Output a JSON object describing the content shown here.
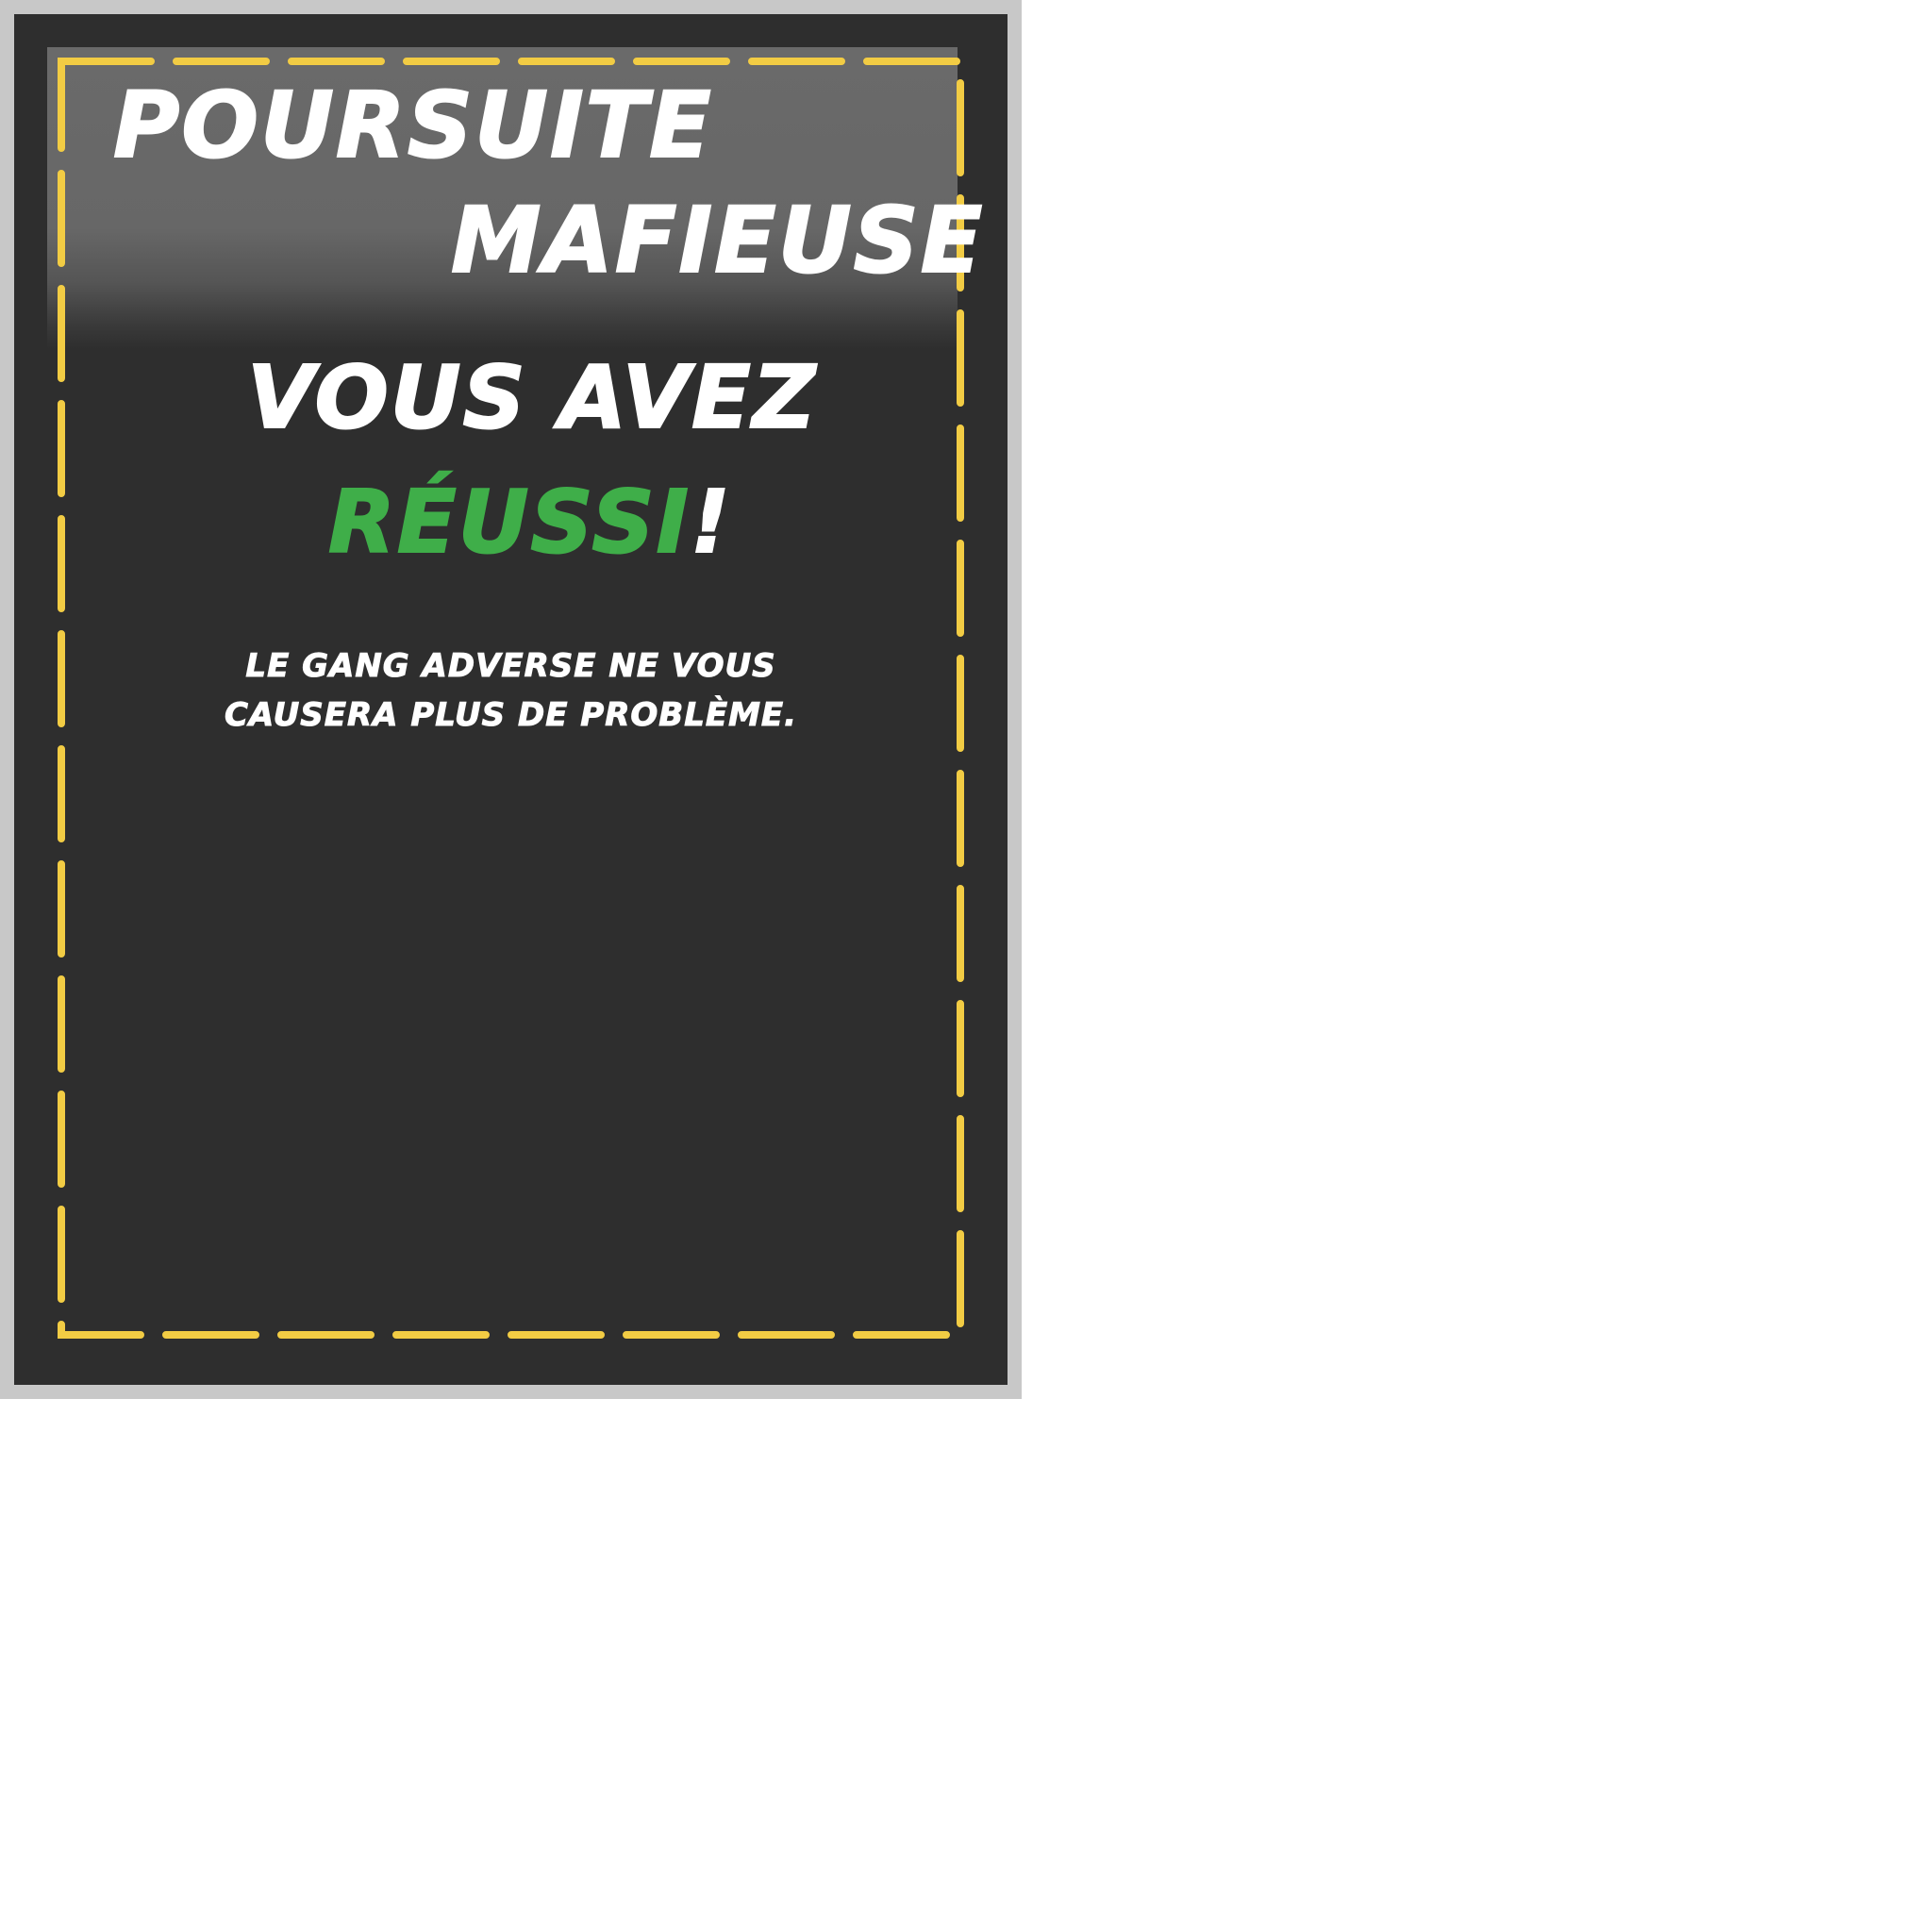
{
  "card": {
    "title_line1": "Poursuite",
    "title_line2": "Mafieuse",
    "headline_line1": "Vous avez",
    "headline_success": "Réussi",
    "headline_punct": "!",
    "message_line1": "Le gang adverse ne vous",
    "message_line2": "causera plus de problème."
  },
  "colors": {
    "background": "#2e2e2e",
    "border_dash": "#f2cc44",
    "title_band": "#6a6a6a",
    "success": "#3fae49",
    "text": "#ffffff"
  }
}
